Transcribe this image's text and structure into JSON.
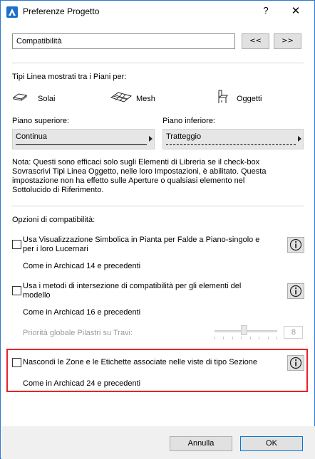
{
  "window": {
    "title": "Preferenze Progetto",
    "help_glyph": "?",
    "close_glyph": "✕"
  },
  "top": {
    "dropdown_value": "Compatibilità",
    "prev_label": "<<",
    "next_label": ">>"
  },
  "linetypes": {
    "heading": "Tipi Linea mostrati tra i Piani per:",
    "slabs": "Solai",
    "mesh": "Mesh",
    "objects": "Oggetti"
  },
  "floors": {
    "upper_label": "Piano superiore:",
    "upper_value": "Continua",
    "lower_label": "Piano inferiore:",
    "lower_value": "Tratteggio"
  },
  "note": {
    "line1": "Nota: Questi sono efficaci solo sugli Elementi di Libreria se il check-box",
    "line2": "Sovrascrivi Tipi Linea Oggetto, nelle loro Impostazioni, è abilitato. Questa",
    "line3": "impostazione non ha effetto sulle Aperture o qualsiasi elemento nel",
    "line4": "Sottolucido di Riferimento."
  },
  "compat": {
    "heading": "Opzioni di compatibilità:",
    "opt1_line1": "Usa Visualizzazione Simbolica in Pianta per Falde a Piano-singolo e",
    "opt1_line2": "per i loro Lucernari",
    "opt1_sub": "Come in Archicad 14 e precedenti",
    "opt1_checked": false,
    "opt2_line1": "Usa i metodi di intersezione di compatibilità per gli elementi del",
    "opt2_line2": "modello",
    "opt2_sub": "Come in Archicad 16 e precedenti",
    "opt2_checked": false,
    "priority_label": "Priorità globale Pilastri su Travi:",
    "priority_value": "8",
    "opt3_line1": "Nascondi le Zone e le Etichette associate nelle viste di tipo Sezione",
    "opt3_sub": "Come in Archicad 24 e precedenti",
    "opt3_checked": false
  },
  "buttons": {
    "cancel": "Annulla",
    "ok": "OK"
  },
  "colors": {
    "highlight": "#e8232a",
    "title_border": "#2b79d0",
    "ok_focus": "#0078d7"
  }
}
